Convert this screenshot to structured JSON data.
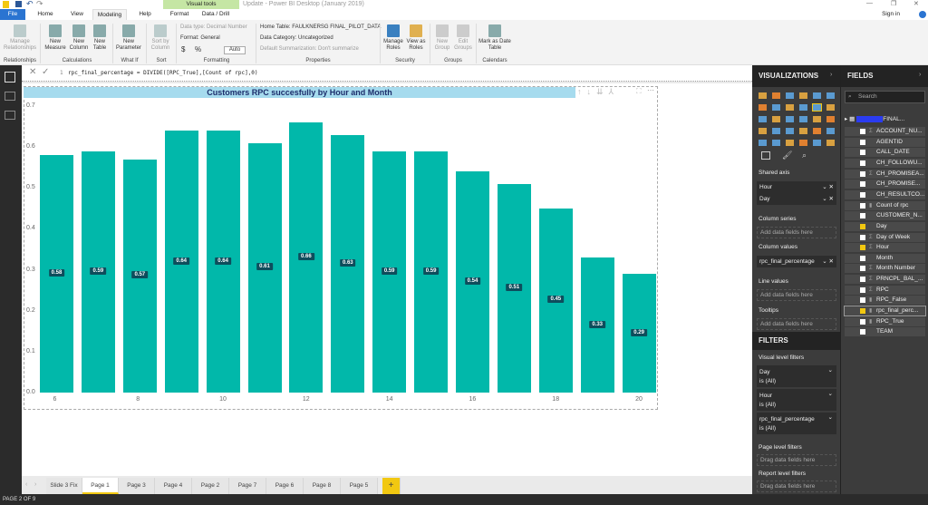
{
  "window": {
    "title": "Update - Power BI Desktop (January 2019)",
    "sign_in": "Sign in",
    "contextual_group": "Visual tools"
  },
  "ribbon_tabs": [
    "File",
    "Home",
    "View",
    "Modeling",
    "Help",
    "Format",
    "Data / Drill"
  ],
  "ribbon": {
    "buttons": [
      {
        "label": "Manage Relationships",
        "group": "Relationships"
      },
      {
        "label": "New Measure"
      },
      {
        "label": "New Column"
      },
      {
        "label": "New Table"
      },
      {
        "label": "New Parameter"
      },
      {
        "label": "Sort by Column"
      },
      {
        "label": "Manage Roles"
      },
      {
        "label": "View as Roles"
      },
      {
        "label": "New Group"
      },
      {
        "label": "Edit Groups"
      },
      {
        "label": "Mark as Date Table"
      }
    ],
    "groups": [
      "Relationships",
      "Calculations",
      "What If",
      "Sort",
      "Formatting",
      "Properties",
      "Security",
      "Groups",
      "Calendars"
    ],
    "data_type": "Data type: Decimal Number",
    "format": "Format: General",
    "currency": "$",
    "percent": "%",
    "auto": "Auto",
    "home_table": "Home Table: FAULKNERSG FINAL_PILOT_DATA",
    "data_category": "Data Category: Uncategorized",
    "default_summarization": "Default Summarization: Don't summarize"
  },
  "formula": {
    "line": "1",
    "text": "rpc_final_percentage = DIVIDE([RPC_True],[Count of rpc],0)"
  },
  "chart_data": {
    "type": "bar",
    "title": "Customers RPC succesfully by Hour and Month",
    "x": [
      6,
      7,
      8,
      9,
      10,
      11,
      12,
      13,
      14,
      15,
      16,
      17,
      18,
      19,
      20
    ],
    "x_tick_labels": [
      "6",
      "8",
      "10",
      "12",
      "14",
      "16",
      "18",
      "20"
    ],
    "values": [
      0.58,
      0.59,
      0.57,
      0.64,
      0.64,
      0.61,
      0.66,
      0.63,
      0.59,
      0.59,
      0.54,
      0.51,
      0.45,
      0.33,
      0.29
    ],
    "y_ticks": [
      "0.0",
      "0.1",
      "0.2",
      "0.3",
      "0.4",
      "0.5",
      "0.6",
      "0.7"
    ],
    "ylim": [
      0,
      0.7
    ],
    "color": "#01B8AA",
    "grid": false
  },
  "page_tabs": [
    "Slide 3 Fix",
    "Page 1",
    "Page 3",
    "Page 4",
    "Page 2",
    "Page 7",
    "Page 6",
    "Page 8",
    "Page 5"
  ],
  "active_tab": "Page 1",
  "status": "PAGE 2 OF 9",
  "visualizations": {
    "title": "VISUALIZATIONS",
    "shared_axis_label": "Shared axis",
    "shared_axis": [
      "Hour",
      "Day"
    ],
    "column_series_label": "Column series",
    "column_values_label": "Column values",
    "column_values": "rpc_final_percentage",
    "line_values_label": "Line values",
    "tooltips_label": "Tooltips",
    "drop_hint": "Add data fields here"
  },
  "filters": {
    "title": "FILTERS",
    "visual_level": "Visual level filters",
    "items": [
      {
        "name": "Day",
        "state": "is (All)"
      },
      {
        "name": "Hour",
        "state": "is (All)"
      },
      {
        "name": "rpc_final_percentage",
        "state": "is (All)"
      }
    ],
    "page_level": "Page level filters",
    "report_level": "Report level filters",
    "drag_hint": "Drag data fields here"
  },
  "fields": {
    "title": "FIELDS",
    "search_placeholder": "Search",
    "table": "FINAL...",
    "items": [
      {
        "name": "ACCOUNT_NU...",
        "sigma": true
      },
      {
        "name": "AGENTID"
      },
      {
        "name": "CALL_DATE"
      },
      {
        "name": "CH_FOLLOWU..."
      },
      {
        "name": "CH_PROMISEA...",
        "sigma": true
      },
      {
        "name": "CH_PROMISE..."
      },
      {
        "name": "CH_RESULTCO..."
      },
      {
        "name": "Count of rpc",
        "measure": true
      },
      {
        "name": "CUSTOMER_N..."
      },
      {
        "name": "Day",
        "checked": true
      },
      {
        "name": "Day of Week",
        "sigma": true
      },
      {
        "name": "Hour",
        "checked": true,
        "sigma": true
      },
      {
        "name": "Month"
      },
      {
        "name": "Month Number",
        "sigma": true
      },
      {
        "name": "PRNCPL_BAL_...",
        "sigma": true
      },
      {
        "name": "RPC",
        "sigma": true
      },
      {
        "name": "RPC_False",
        "measure": true
      },
      {
        "name": "rpc_final_perc...",
        "checked": true,
        "measure": true
      },
      {
        "name": "RPC_True",
        "measure": true
      },
      {
        "name": "TEAM"
      }
    ]
  }
}
